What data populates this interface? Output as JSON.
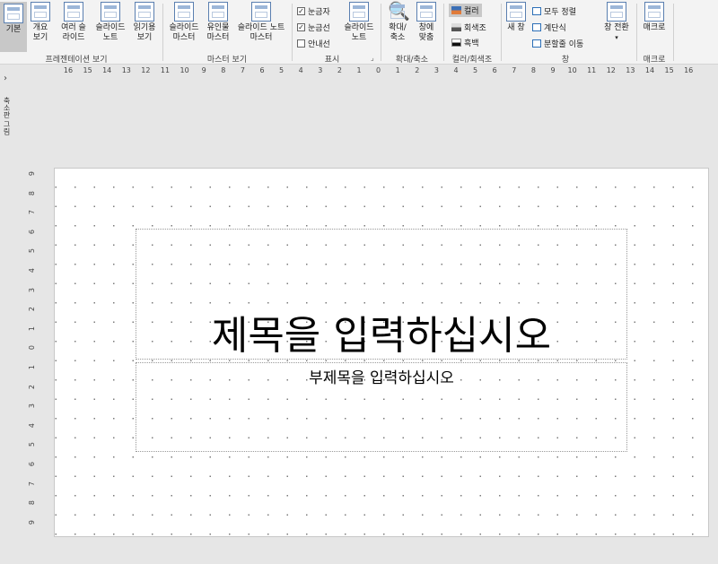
{
  "ribbon": {
    "presentation_views": {
      "group_label": "프레젠테이션 보기",
      "buttons": [
        "기본",
        "개요 보기",
        "여러 슬라이드",
        "슬라이드 노트",
        "읽기용 보기"
      ]
    },
    "master_views": {
      "group_label": "마스터 보기",
      "buttons": [
        "슬라이드 마스터",
        "유인물 마스터",
        "슬라이드 노트 마스터"
      ]
    },
    "show": {
      "group_label": "표시",
      "checkboxes": [
        {
          "label": "눈금자",
          "checked": true
        },
        {
          "label": "눈금선",
          "checked": true
        },
        {
          "label": "안내선",
          "checked": false
        }
      ],
      "notes_button": "슬라이드 노트"
    },
    "zoom": {
      "group_label": "확대/축소",
      "buttons": [
        "확대/ 축소",
        "창에 맞춤"
      ]
    },
    "color": {
      "group_label": "컬러/회색조",
      "items": [
        {
          "label": "컬러",
          "color": "#3b6fb6",
          "selected": true
        },
        {
          "label": "회색조",
          "color": "#777777",
          "selected": false
        },
        {
          "label": "흑백",
          "color": "#111111",
          "selected": false
        }
      ]
    },
    "window": {
      "group_label": "창",
      "new_window": "새 창",
      "items": [
        "모두 정렬",
        "계단식",
        "분할줄 이동"
      ],
      "switch": "창 전환"
    },
    "macros": {
      "group_label": "매크로",
      "button": "매크로"
    }
  },
  "side_panel": {
    "toggle": "›",
    "label": "축소판 그림"
  },
  "hruler_labels": [
    "16",
    "15",
    "14",
    "13",
    "12",
    "11",
    "10",
    "9",
    "8",
    "7",
    "6",
    "5",
    "4",
    "3",
    "2",
    "1",
    "0",
    "1",
    "2",
    "3",
    "4",
    "5",
    "6",
    "7",
    "8",
    "9",
    "10",
    "11",
    "12",
    "13",
    "14",
    "15",
    "16"
  ],
  "vruler_labels": [
    "9",
    "8",
    "7",
    "6",
    "5",
    "4",
    "3",
    "2",
    "1",
    "0",
    "1",
    "2",
    "3",
    "4",
    "5",
    "6",
    "7",
    "8",
    "9"
  ],
  "slide": {
    "title": "제목을 입력하십시오",
    "subtitle": "부제목을 입력하십시오"
  }
}
